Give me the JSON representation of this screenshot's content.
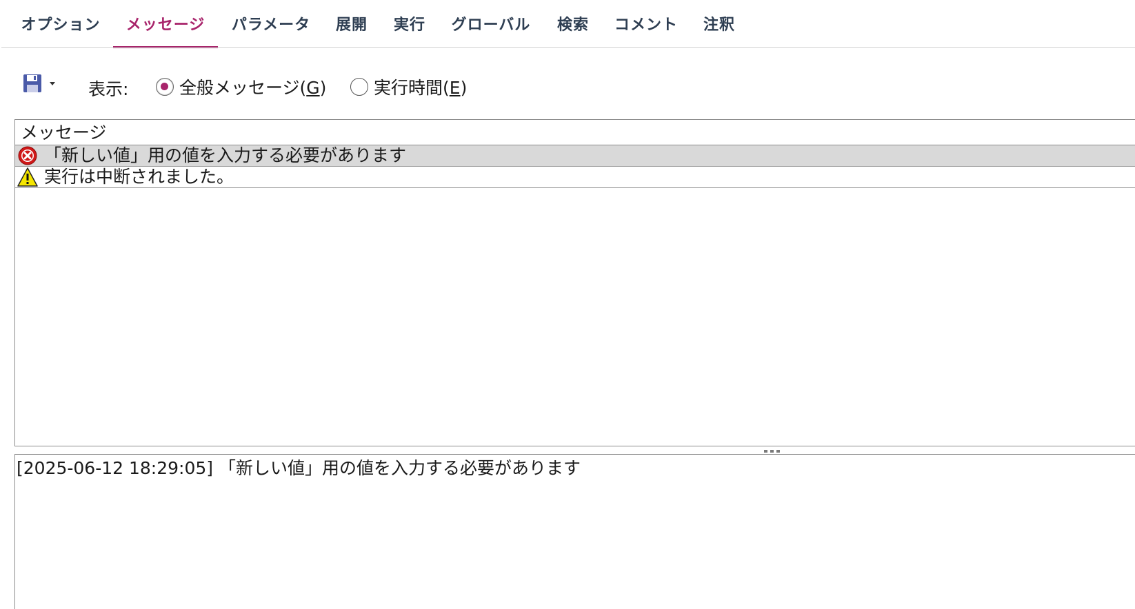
{
  "tabs": [
    {
      "label": "オプション",
      "active": false
    },
    {
      "label": "メッセージ",
      "active": true
    },
    {
      "label": "パラメータ",
      "active": false
    },
    {
      "label": "展開",
      "active": false
    },
    {
      "label": "実行",
      "active": false
    },
    {
      "label": "グローバル",
      "active": false
    },
    {
      "label": "検索",
      "active": false
    },
    {
      "label": "コメント",
      "active": false
    },
    {
      "label": "注釈",
      "active": false
    }
  ],
  "toolbar": {
    "save_icon": "floppy-disk-icon",
    "show_label": "表示:",
    "radio_general": {
      "text": "全般メッセージ(",
      "mnemonic": "G",
      "suffix": ")",
      "checked": true
    },
    "radio_exec": {
      "text": "実行時間(",
      "mnemonic": "E",
      "suffix": ")",
      "checked": false
    }
  },
  "messages": {
    "header": "メッセージ",
    "rows": [
      {
        "icon": "error-icon",
        "text": "「新しい値」用の値を入力する必要があります",
        "selected": true
      },
      {
        "icon": "warning-icon",
        "text": "実行は中断されました。",
        "selected": false
      }
    ]
  },
  "detail": {
    "text": "[2025-06-12 18:29:05] 「新しい値」用の値を入力する必要があります"
  },
  "colors": {
    "accent": "#a8246b",
    "tab_text": "#2e3e52",
    "selected_row": "#d9d9d9",
    "error": "#d01818",
    "warning": "#f5e600"
  }
}
